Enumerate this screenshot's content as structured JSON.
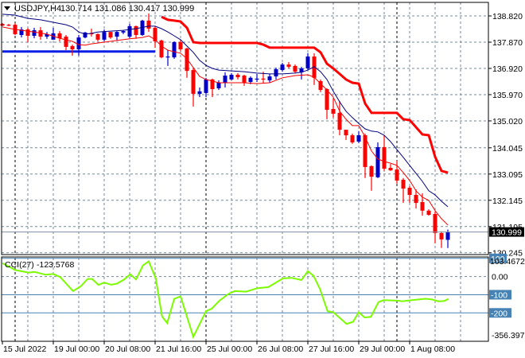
{
  "header": {
    "symbol": "USDJPY,H4",
    "ohlc": "130.714 131.086 130.417 130.999",
    "menu_icon": "triangle-down-icon"
  },
  "colors": {
    "bull": "#0000c8",
    "bear": "#ff0000",
    "ma_slow": "#000080",
    "ma_fast": "#ff0000",
    "stop_line": "#ff0000",
    "support_line": "#0a1ee6",
    "cci": "#7cfc00",
    "cci_levels": "#4682b4",
    "grid": "#778899",
    "separator": "#000000"
  },
  "chart_data": [
    {
      "type": "candlestick",
      "title": "USDJPY,H4",
      "ylim": [
        130.18,
        139.31
      ],
      "xlim": [
        -0.125,
        76.375
      ],
      "y_ticks": [
        "138.820",
        "137.870",
        "136.920",
        "135.970",
        "135.020",
        "134.045",
        "133.095",
        "132.145",
        "131.195",
        "130.245"
      ],
      "current_price": "130.999",
      "x_labels": [
        {
          "bar": 0,
          "label": "15 Jul 2022"
        },
        {
          "bar": 8,
          "label": "19 Jul 00:00"
        },
        {
          "bar": 16,
          "label": "20 Jul 08:00"
        },
        {
          "bar": 24,
          "label": "21 Jul 16:00"
        },
        {
          "bar": 32,
          "label": "25 Jul 00:00"
        },
        {
          "bar": 40,
          "label": "26 Jul 08:00"
        },
        {
          "bar": 48,
          "label": "27 Jul 16:00"
        },
        {
          "bar": 56,
          "label": "29 Jul 00:00"
        },
        {
          "bar": 64,
          "label": "1 Aug 08:00"
        }
      ],
      "candles_ohlc": [
        [
          138.53,
          138.56,
          138.45,
          138.47
        ],
        [
          138.5,
          138.53,
          138.45,
          138.47
        ],
        [
          138.5,
          138.56,
          138.13,
          138.16
        ],
        [
          138.13,
          138.42,
          138.04,
          138.33
        ],
        [
          138.33,
          138.39,
          137.87,
          138.1
        ],
        [
          138.1,
          138.39,
          138.01,
          138.3
        ],
        [
          138.3,
          138.42,
          137.96,
          138.07
        ],
        [
          138.07,
          138.24,
          137.99,
          138.16
        ],
        [
          137.96,
          138.39,
          137.96,
          138.19
        ],
        [
          138.19,
          138.27,
          137.9,
          138.01
        ],
        [
          138.07,
          138.13,
          137.58,
          137.7
        ],
        [
          137.73,
          137.78,
          137.38,
          137.61
        ],
        [
          137.61,
          138.13,
          137.38,
          138.04
        ],
        [
          138.04,
          138.24,
          138.01,
          138.22
        ],
        [
          138.19,
          138.36,
          138.07,
          138.16
        ],
        [
          138.16,
          138.19,
          137.9,
          137.96
        ],
        [
          137.96,
          138.33,
          137.9,
          138.24
        ],
        [
          138.24,
          138.24,
          137.99,
          138.04
        ],
        [
          138.07,
          138.27,
          137.93,
          138.24
        ],
        [
          138.22,
          138.3,
          138.16,
          138.27
        ],
        [
          138.07,
          138.53,
          138.01,
          138.45
        ],
        [
          138.45,
          138.47,
          137.99,
          138.13
        ],
        [
          138.13,
          138.68,
          138.1,
          138.65
        ],
        [
          138.65,
          138.91,
          138.24,
          138.36
        ],
        [
          138.39,
          138.45,
          137.67,
          137.9
        ],
        [
          137.93,
          137.96,
          137.29,
          137.32
        ],
        [
          137.32,
          137.58,
          137.01,
          137.35
        ],
        [
          137.32,
          137.9,
          137.27,
          137.87
        ],
        [
          137.87,
          137.96,
          137.53,
          137.61
        ],
        [
          137.64,
          137.67,
          136.58,
          136.83
        ],
        [
          136.86,
          136.92,
          135.54,
          136.0
        ],
        [
          136.0,
          136.23,
          135.88,
          136.09
        ],
        [
          136.03,
          136.58,
          135.88,
          136.52
        ],
        [
          136.52,
          136.55,
          135.88,
          136.17
        ],
        [
          136.2,
          136.49,
          136.14,
          136.4
        ],
        [
          136.4,
          136.78,
          136.23,
          136.66
        ],
        [
          136.52,
          136.75,
          136.49,
          136.69
        ],
        [
          136.69,
          136.75,
          136.52,
          136.6
        ],
        [
          136.66,
          136.69,
          136.29,
          136.4
        ],
        [
          136.43,
          136.63,
          136.35,
          136.58
        ],
        [
          136.52,
          136.72,
          136.43,
          136.55
        ],
        [
          136.55,
          136.8,
          136.37,
          136.52
        ],
        [
          136.49,
          136.72,
          136.4,
          136.63
        ],
        [
          136.63,
          136.95,
          136.52,
          136.89
        ],
        [
          136.86,
          137.12,
          136.8,
          137.06
        ],
        [
          137.06,
          137.15,
          136.92,
          136.98
        ],
        [
          137.01,
          137.06,
          136.75,
          136.8
        ],
        [
          136.78,
          136.98,
          136.52,
          136.92
        ],
        [
          136.92,
          137.47,
          136.86,
          137.35
        ],
        [
          137.35,
          137.47,
          136.32,
          136.58
        ],
        [
          136.46,
          136.52,
          136.06,
          136.14
        ],
        [
          136.17,
          136.2,
          135.08,
          135.42
        ],
        [
          135.45,
          135.83,
          135.14,
          135.28
        ],
        [
          135.31,
          135.74,
          134.5,
          134.7
        ],
        [
          134.7,
          134.7,
          134.33,
          134.5
        ],
        [
          134.5,
          134.56,
          134.19,
          134.24
        ],
        [
          134.27,
          134.65,
          134.21,
          134.5
        ],
        [
          134.5,
          134.56,
          132.95,
          133.35
        ],
        [
          133.38,
          133.41,
          132.49,
          133.0
        ],
        [
          132.98,
          134.24,
          132.95,
          134.07
        ],
        [
          134.07,
          134.5,
          133.21,
          133.29
        ],
        [
          133.32,
          133.46,
          133.21,
          133.23
        ],
        [
          133.26,
          133.58,
          132.75,
          132.86
        ],
        [
          132.89,
          132.95,
          132.05,
          132.57
        ],
        [
          132.6,
          132.66,
          132.05,
          132.34
        ],
        [
          132.34,
          132.54,
          131.85,
          132.05
        ],
        [
          132.08,
          132.4,
          131.59,
          131.77
        ],
        [
          131.77,
          131.82,
          131.59,
          131.62
        ],
        [
          131.65,
          131.74,
          130.59,
          130.96
        ],
        [
          130.96,
          131.02,
          130.42,
          130.73
        ],
        [
          130.714,
          131.086,
          130.417,
          130.999
        ]
      ],
      "ma_slow": [
        [
          0,
          138.88
        ],
        [
          2,
          138.85
        ],
        [
          4,
          138.73
        ],
        [
          6,
          138.68
        ],
        [
          8,
          138.59
        ],
        [
          10,
          138.5
        ],
        [
          11,
          138.42
        ],
        [
          12,
          138.24
        ],
        [
          13,
          138.16
        ],
        [
          14,
          138.19
        ],
        [
          15,
          138.24
        ],
        [
          17,
          138.27
        ],
        [
          19,
          138.3
        ],
        [
          21,
          138.36
        ],
        [
          23,
          138.45
        ],
        [
          24,
          138.45
        ],
        [
          25,
          138.36
        ],
        [
          26,
          138.24
        ],
        [
          27,
          138.1
        ],
        [
          28,
          137.96
        ],
        [
          29,
          137.73
        ],
        [
          30,
          137.5
        ],
        [
          31,
          137.21
        ],
        [
          32,
          137.03
        ],
        [
          33,
          136.92
        ],
        [
          34,
          136.86
        ],
        [
          36,
          136.83
        ],
        [
          38,
          136.8
        ],
        [
          40,
          136.75
        ],
        [
          42,
          136.72
        ],
        [
          44,
          136.72
        ],
        [
          46,
          136.75
        ],
        [
          47,
          136.78
        ],
        [
          48,
          136.86
        ],
        [
          49,
          136.98
        ],
        [
          50,
          136.8
        ],
        [
          51,
          136.52
        ],
        [
          52,
          136.09
        ],
        [
          53,
          135.71
        ],
        [
          54,
          135.37
        ],
        [
          55,
          135.14
        ],
        [
          56,
          134.93
        ],
        [
          57,
          134.73
        ],
        [
          58,
          134.65
        ],
        [
          59,
          134.62
        ],
        [
          60,
          134.5
        ],
        [
          61,
          134.27
        ],
        [
          62,
          133.98
        ],
        [
          63,
          133.7
        ],
        [
          64,
          133.41
        ],
        [
          65,
          133.12
        ],
        [
          66,
          132.83
        ],
        [
          67,
          132.49
        ],
        [
          68,
          132.34
        ],
        [
          69,
          132.11
        ],
        [
          70,
          131.91
        ]
      ],
      "ma_fast": [
        [
          0,
          138.42
        ],
        [
          2,
          138.33
        ],
        [
          5,
          138.24
        ],
        [
          7,
          138.16
        ],
        [
          9,
          138.01
        ],
        [
          11,
          137.9
        ],
        [
          12,
          137.78
        ],
        [
          13,
          137.76
        ],
        [
          14,
          137.81
        ],
        [
          16,
          137.87
        ],
        [
          18,
          137.93
        ],
        [
          20,
          137.99
        ],
        [
          22,
          138.04
        ],
        [
          23,
          138.1
        ],
        [
          24,
          137.96
        ],
        [
          25,
          137.73
        ],
        [
          26,
          137.58
        ],
        [
          28,
          137.47
        ],
        [
          29,
          137.27
        ],
        [
          30,
          136.95
        ],
        [
          31,
          136.63
        ],
        [
          32,
          136.52
        ],
        [
          34,
          136.4
        ],
        [
          36,
          136.4
        ],
        [
          38,
          136.4
        ],
        [
          40,
          136.37
        ],
        [
          42,
          136.4
        ],
        [
          44,
          136.58
        ],
        [
          46,
          136.66
        ],
        [
          48,
          136.69
        ],
        [
          49,
          136.6
        ],
        [
          50,
          136.37
        ],
        [
          51,
          136.14
        ],
        [
          52,
          135.88
        ],
        [
          53,
          135.37
        ],
        [
          54,
          135.08
        ],
        [
          55,
          134.85
        ],
        [
          56,
          134.85
        ],
        [
          57,
          134.44
        ],
        [
          58,
          133.93
        ],
        [
          59,
          133.64
        ],
        [
          60,
          133.55
        ],
        [
          61,
          133.49
        ],
        [
          62,
          133.41
        ],
        [
          63,
          133.15
        ],
        [
          64,
          132.86
        ],
        [
          65,
          132.49
        ],
        [
          66,
          132.26
        ],
        [
          67,
          132.14
        ],
        [
          68,
          131.77
        ],
        [
          69,
          131.48
        ],
        [
          70,
          131.25
        ]
      ],
      "stop_line": [
        [
          25,
          138.79
        ],
        [
          26,
          138.68
        ],
        [
          27,
          138.65
        ],
        [
          28,
          138.62
        ],
        [
          29,
          138.39
        ],
        [
          30,
          137.87
        ],
        [
          31,
          137.84
        ],
        [
          40,
          137.84
        ],
        [
          41,
          137.78
        ],
        [
          42,
          137.67
        ],
        [
          49,
          137.67
        ],
        [
          50,
          137.5
        ],
        [
          51,
          137.09
        ],
        [
          52,
          136.92
        ],
        [
          53,
          136.72
        ],
        [
          54,
          136.52
        ],
        [
          55,
          136.4
        ],
        [
          56,
          136.37
        ],
        [
          57,
          135.65
        ],
        [
          58,
          135.31
        ],
        [
          62,
          135.31
        ],
        [
          63,
          135.08
        ],
        [
          64,
          135.05
        ],
        [
          65,
          134.79
        ],
        [
          66,
          134.53
        ],
        [
          67,
          134.5
        ],
        [
          68,
          133.72
        ],
        [
          69,
          133.21
        ],
        [
          70,
          133.15
        ]
      ],
      "support_line": {
        "price": 137.53,
        "from_bar": 0,
        "to_bar": 24
      }
    },
    {
      "type": "line",
      "title": "CCI(27)",
      "value": "-123.5768",
      "ylim": [
        -356.397,
        103.4672
      ],
      "y_labels": {
        "max": "103.4672",
        "zero": "0.00",
        "min": "-356.397"
      },
      "levels": [
        {
          "value": 100,
          "label": "100"
        },
        {
          "value": -100,
          "label": "-100"
        },
        {
          "value": -200,
          "label": "-200"
        }
      ],
      "points": [
        [
          0,
          74
        ],
        [
          2,
          36
        ],
        [
          4.1,
          22
        ],
        [
          5.1,
          25
        ],
        [
          6.8,
          10
        ],
        [
          8,
          14
        ],
        [
          9.1,
          -3
        ],
        [
          11.1,
          -80
        ],
        [
          12.3,
          -54
        ],
        [
          13.4,
          -13
        ],
        [
          14.1,
          -13
        ],
        [
          15.1,
          -46
        ],
        [
          16,
          -33
        ],
        [
          17.1,
          -45
        ],
        [
          18,
          -39
        ],
        [
          19.1,
          -17
        ],
        [
          20.1,
          13
        ],
        [
          21,
          -16
        ],
        [
          22.1,
          62
        ],
        [
          23,
          84
        ],
        [
          24.1,
          -10
        ],
        [
          25.1,
          -220
        ],
        [
          25.9,
          -256
        ],
        [
          27,
          -123
        ],
        [
          28,
          -109
        ],
        [
          30,
          -332
        ],
        [
          32,
          -191
        ],
        [
          32.9,
          -177
        ],
        [
          34.1,
          -133
        ],
        [
          35.6,
          -94
        ],
        [
          36.5,
          -80
        ],
        [
          38.3,
          -83
        ],
        [
          40.1,
          -64
        ],
        [
          41.8,
          -58
        ],
        [
          44.1,
          -10
        ],
        [
          45.4,
          -7
        ],
        [
          47,
          -19
        ],
        [
          48,
          30
        ],
        [
          48.9,
          4
        ],
        [
          49.9,
          -68
        ],
        [
          51.1,
          -191
        ],
        [
          52,
          -196
        ],
        [
          54.1,
          -261
        ],
        [
          55.1,
          -249
        ],
        [
          56,
          -196
        ],
        [
          56.9,
          -225
        ],
        [
          57.9,
          -222
        ],
        [
          59.1,
          -141
        ],
        [
          59.9,
          -130
        ],
        [
          62.3,
          -133
        ],
        [
          62.8,
          -136
        ],
        [
          64.4,
          -130
        ],
        [
          66.5,
          -122
        ],
        [
          67.5,
          -126
        ],
        [
          68.5,
          -136
        ],
        [
          69.4,
          -135
        ],
        [
          70.1,
          -123.58
        ]
      ]
    }
  ]
}
